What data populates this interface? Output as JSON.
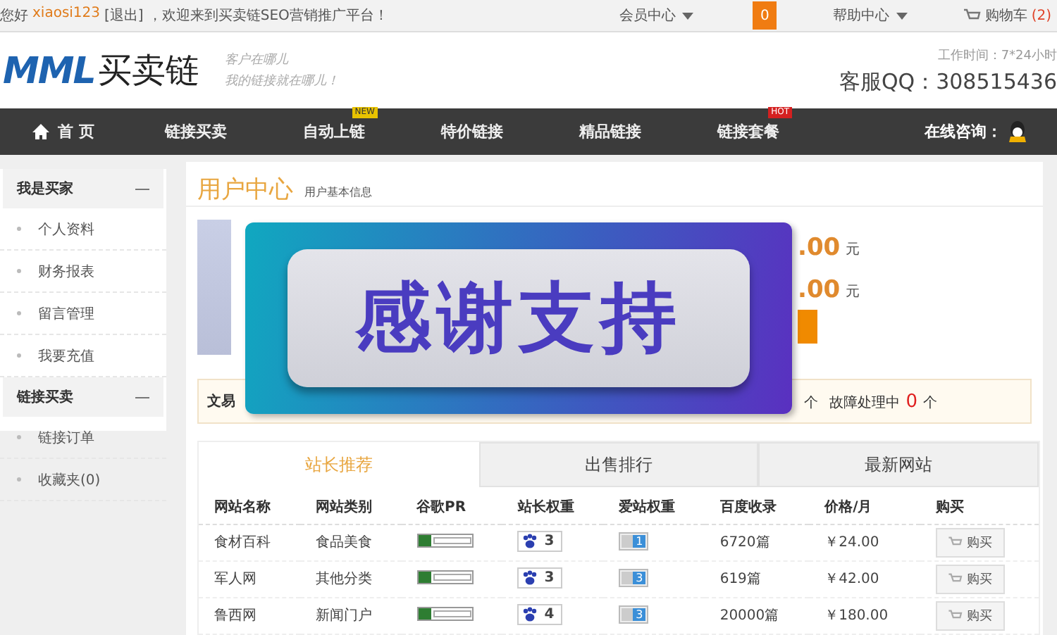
{
  "top_bar": {
    "greeting": "您好",
    "username": "xiaosi123",
    "logout": "[退出]",
    "welcome": "，欢迎来到买卖链SEO营销推广平台！",
    "links": [
      {
        "label": "会员中心",
        "kind": "dropdown"
      },
      {
        "label": "0",
        "kind": "badge"
      },
      {
        "label": "帮助中心",
        "kind": "dropdown"
      },
      {
        "label": "购物车",
        "count": "(2)",
        "kind": "cart"
      }
    ]
  },
  "header": {
    "logo_mark": "MML",
    "logo_text": "买卖链",
    "slogan": [
      "客户在哪儿",
      "我的链接就在哪儿！"
    ],
    "hours": "工作时间：7*24小时",
    "qq": "客服QQ：308515436"
  },
  "nav": {
    "items": [
      {
        "label": "首 页",
        "home": true
      },
      {
        "label": "链接买卖",
        "home": false
      },
      {
        "label": "自动上链",
        "home": false,
        "tag": "NEW"
      },
      {
        "label": "特价链接",
        "home": false
      },
      {
        "label": "精品链接",
        "home": false
      },
      {
        "label": "链接套餐",
        "home": false,
        "tag": "HOT"
      }
    ],
    "consult": "在线咨询："
  },
  "sidebar": {
    "groups": [
      {
        "title": "我是买家",
        "expanded": true,
        "items": [
          "个人资料",
          "财务报表",
          "留言管理",
          "我要充值"
        ]
      },
      {
        "title": "链接买卖",
        "expanded": true,
        "items": [
          "链接订单",
          "收藏夹(0)"
        ]
      }
    ]
  },
  "main": {
    "title": "用户中心",
    "subtitle": "用户基本信息",
    "amounts": [
      {
        "value": ".00",
        "unit": "元"
      },
      {
        "value": ".00",
        "unit": "元"
      }
    ],
    "stats": [
      {
        "label": "文易"
      },
      {
        "unit": "个"
      },
      {
        "label": "故障处理中",
        "value": "0",
        "unit": "个"
      }
    ],
    "overlay": {
      "text": "感谢支持"
    },
    "tabs": [
      {
        "label": "站长推荐",
        "selected": true
      },
      {
        "label": "出售排行",
        "selected": false
      },
      {
        "label": "最新网站",
        "selected": false
      }
    ],
    "table": {
      "columns": [
        "网站名称",
        "网站类别",
        "谷歌PR",
        "站长权重",
        "爱站权重",
        "百度收录",
        "价格/月",
        "购买"
      ],
      "rows": [
        {
          "name": "食材百科",
          "category": "食品美食",
          "chinaz": "3",
          "aizhan": "1",
          "baidu": "6720篇",
          "price": "￥24.00",
          "buy": "购买"
        },
        {
          "name": "军人网",
          "category": "其他分类",
          "chinaz": "3",
          "aizhan": "3",
          "baidu": "619篇",
          "price": "￥42.00",
          "buy": "购买"
        },
        {
          "name": "鲁西网",
          "category": "新闻门户",
          "chinaz": "4",
          "aizhan": "3",
          "baidu": "20000篇",
          "price": "￥180.00",
          "buy": "购买"
        }
      ]
    }
  }
}
